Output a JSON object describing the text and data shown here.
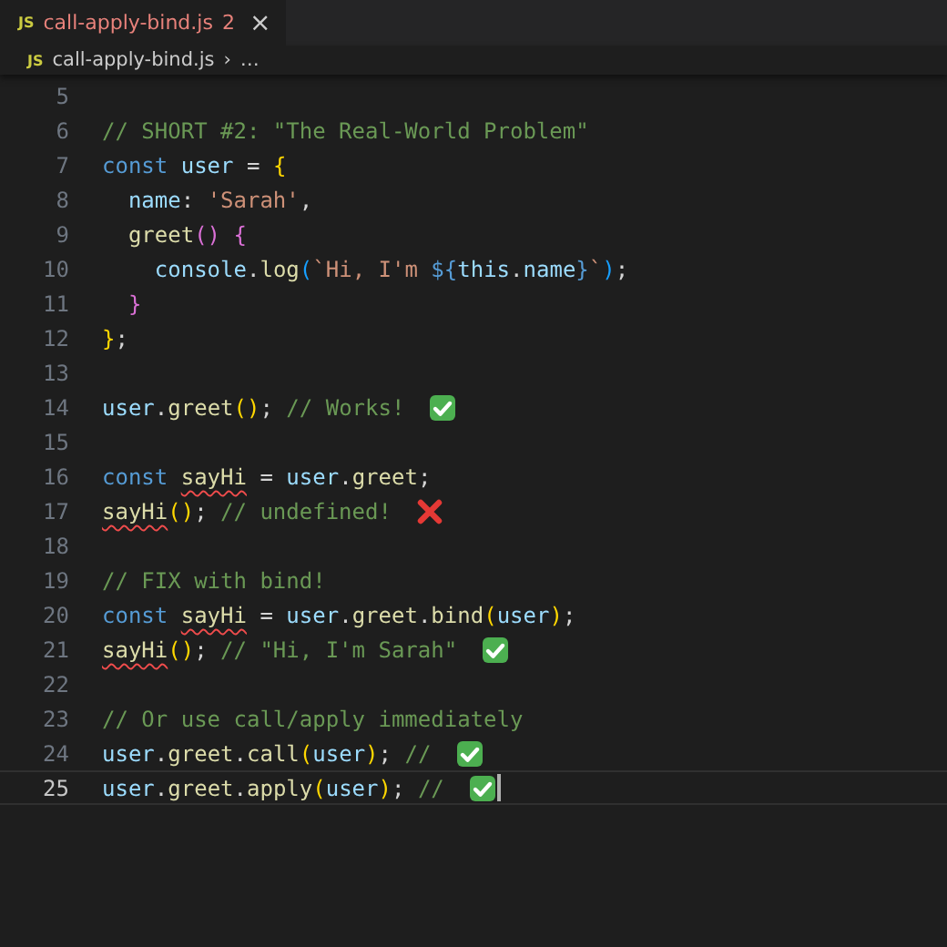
{
  "tab": {
    "icon_text": "JS",
    "label": "call-apply-bind.js",
    "problems": "2",
    "close": "×"
  },
  "breadcrumb": {
    "icon_text": "JS",
    "file": "call-apply-bind.js",
    "separator": "›",
    "rest": "…"
  },
  "lines": [
    {
      "number": "5",
      "current": false
    },
    {
      "number": "6",
      "current": false,
      "tokens": [
        {
          "kind": "cmt",
          "text": "// SHORT #2: \"The Real-World Problem\""
        }
      ]
    },
    {
      "number": "7",
      "current": false,
      "tokens": [
        {
          "kind": "kw",
          "text": "const "
        },
        {
          "kind": "var",
          "text": "user"
        },
        {
          "kind": "plain",
          "text": " = "
        },
        {
          "kind": "b1",
          "text": "{"
        }
      ]
    },
    {
      "number": "8",
      "current": false,
      "tokens": [
        {
          "kind": "prop",
          "text": "  name"
        },
        {
          "kind": "plain",
          "text": ": "
        },
        {
          "kind": "str",
          "text": "'Sarah'"
        },
        {
          "kind": "plain",
          "text": ","
        }
      ]
    },
    {
      "number": "9",
      "current": false,
      "tokens": [
        {
          "kind": "fn",
          "text": "  greet"
        },
        {
          "kind": "b2",
          "text": "() {"
        }
      ]
    },
    {
      "number": "10",
      "current": false,
      "tokens": [
        {
          "kind": "var",
          "text": "    console"
        },
        {
          "kind": "plain",
          "text": "."
        },
        {
          "kind": "fn",
          "text": "log"
        },
        {
          "kind": "b3",
          "text": "("
        },
        {
          "kind": "str",
          "text": "`Hi, I'm "
        },
        {
          "kind": "kw",
          "text": "${"
        },
        {
          "kind": "var",
          "text": "this"
        },
        {
          "kind": "plain",
          "text": "."
        },
        {
          "kind": "var",
          "text": "name"
        },
        {
          "kind": "kw",
          "text": "}"
        },
        {
          "kind": "str",
          "text": "`"
        },
        {
          "kind": "b3",
          "text": ")"
        },
        {
          "kind": "plain",
          "text": ";"
        }
      ]
    },
    {
      "number": "11",
      "current": false,
      "tokens": [
        {
          "kind": "b2",
          "text": "  }"
        }
      ]
    },
    {
      "number": "12",
      "current": false,
      "tokens": [
        {
          "kind": "b1",
          "text": "}"
        },
        {
          "kind": "plain",
          "text": ";"
        }
      ]
    },
    {
      "number": "13",
      "current": false
    },
    {
      "number": "14",
      "current": false,
      "tokens": [
        {
          "kind": "var",
          "text": "user"
        },
        {
          "kind": "plain",
          "text": "."
        },
        {
          "kind": "fn",
          "text": "greet"
        },
        {
          "kind": "b1",
          "text": "()"
        },
        {
          "kind": "plain",
          "text": "; "
        },
        {
          "kind": "cmt",
          "text": "// Works! "
        },
        {
          "kind": "check-emoji"
        }
      ]
    },
    {
      "number": "15",
      "current": false
    },
    {
      "number": "16",
      "current": false,
      "tokens": [
        {
          "kind": "kw",
          "text": "const "
        },
        {
          "kind": "fn-error",
          "text": "sayHi"
        },
        {
          "kind": "plain",
          "text": " = "
        },
        {
          "kind": "var",
          "text": "user"
        },
        {
          "kind": "plain",
          "text": "."
        },
        {
          "kind": "fn",
          "text": "greet"
        },
        {
          "kind": "plain",
          "text": ";"
        }
      ]
    },
    {
      "number": "17",
      "current": false,
      "tokens": [
        {
          "kind": "fn-error",
          "text": "sayHi"
        },
        {
          "kind": "b1",
          "text": "()"
        },
        {
          "kind": "plain",
          "text": "; "
        },
        {
          "kind": "cmt",
          "text": "// undefined! "
        },
        {
          "kind": "cross-emoji"
        }
      ]
    },
    {
      "number": "18",
      "current": false
    },
    {
      "number": "19",
      "current": false,
      "tokens": [
        {
          "kind": "cmt",
          "text": "// FIX with bind!"
        }
      ]
    },
    {
      "number": "20",
      "current": false,
      "tokens": [
        {
          "kind": "kw",
          "text": "const "
        },
        {
          "kind": "fn-error",
          "text": "sayHi"
        },
        {
          "kind": "plain",
          "text": " = "
        },
        {
          "kind": "var",
          "text": "user"
        },
        {
          "kind": "plain",
          "text": "."
        },
        {
          "kind": "fn",
          "text": "greet"
        },
        {
          "kind": "plain",
          "text": "."
        },
        {
          "kind": "fn",
          "text": "bind"
        },
        {
          "kind": "b1",
          "text": "("
        },
        {
          "kind": "var",
          "text": "user"
        },
        {
          "kind": "b1",
          "text": ")"
        },
        {
          "kind": "plain",
          "text": ";"
        }
      ]
    },
    {
      "number": "21",
      "current": false,
      "tokens": [
        {
          "kind": "fn-error",
          "text": "sayHi"
        },
        {
          "kind": "b1",
          "text": "()"
        },
        {
          "kind": "plain",
          "text": "; "
        },
        {
          "kind": "cmt",
          "text": "// \"Hi, I'm Sarah\" "
        },
        {
          "kind": "check-emoji"
        }
      ]
    },
    {
      "number": "22",
      "current": false
    },
    {
      "number": "23",
      "current": false,
      "tokens": [
        {
          "kind": "cmt",
          "text": "// Or use call/apply immediately"
        }
      ]
    },
    {
      "number": "24",
      "current": false,
      "tokens": [
        {
          "kind": "var",
          "text": "user"
        },
        {
          "kind": "plain",
          "text": "."
        },
        {
          "kind": "fn",
          "text": "greet"
        },
        {
          "kind": "plain",
          "text": "."
        },
        {
          "kind": "fn",
          "text": "call"
        },
        {
          "kind": "b1",
          "text": "("
        },
        {
          "kind": "var",
          "text": "user"
        },
        {
          "kind": "b1",
          "text": ")"
        },
        {
          "kind": "plain",
          "text": "; "
        },
        {
          "kind": "cmt",
          "text": "// "
        },
        {
          "kind": "check-emoji"
        }
      ]
    },
    {
      "number": "25",
      "current": true,
      "tokens": [
        {
          "kind": "var",
          "text": "user"
        },
        {
          "kind": "plain",
          "text": "."
        },
        {
          "kind": "fn",
          "text": "greet"
        },
        {
          "kind": "plain",
          "text": "."
        },
        {
          "kind": "fn",
          "text": "apply"
        },
        {
          "kind": "b1",
          "text": "("
        },
        {
          "kind": "var",
          "text": "user"
        },
        {
          "kind": "b1",
          "text": ")"
        },
        {
          "kind": "plain",
          "text": "; "
        },
        {
          "kind": "cmt",
          "text": "// "
        },
        {
          "kind": "check-emoji"
        }
      ]
    }
  ]
}
